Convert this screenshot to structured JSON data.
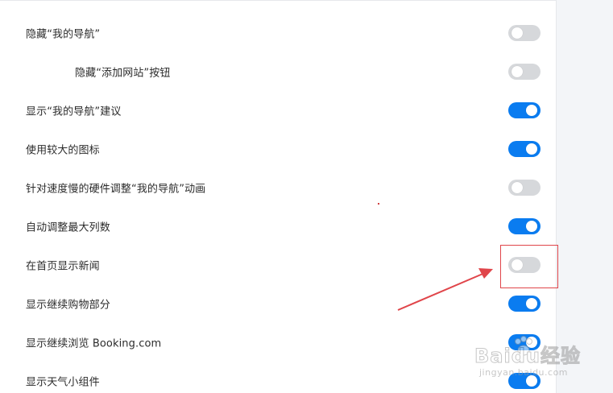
{
  "settings": [
    {
      "label": "隐藏“我的导航”",
      "enabled": false,
      "indent": false
    },
    {
      "label": "隐藏“添加网站”按钮",
      "enabled": false,
      "indent": true
    },
    {
      "label": "显示“我的导航”建议",
      "enabled": true,
      "indent": false
    },
    {
      "label": "使用较大的图标",
      "enabled": true,
      "indent": false
    },
    {
      "label": "针对速度慢的硬件调整“我的导航”动画",
      "enabled": false,
      "indent": false
    },
    {
      "label": "自动调整最大列数",
      "enabled": true,
      "indent": false
    },
    {
      "label": "在首页显示新闻",
      "enabled": false,
      "indent": false
    },
    {
      "label": "显示继续购物部分",
      "enabled": true,
      "indent": false
    },
    {
      "label": "显示继续浏览 Booking.com",
      "enabled": true,
      "indent": false
    },
    {
      "label": "显示天气小组件",
      "enabled": true,
      "indent": false
    }
  ],
  "colors": {
    "toggle_on": "#0a7cf0",
    "toggle_off": "#d6d8db",
    "annotation": "#e0454a"
  },
  "watermark": {
    "brand": "Baidu经验",
    "sub": "jingyan.baidu.com"
  }
}
